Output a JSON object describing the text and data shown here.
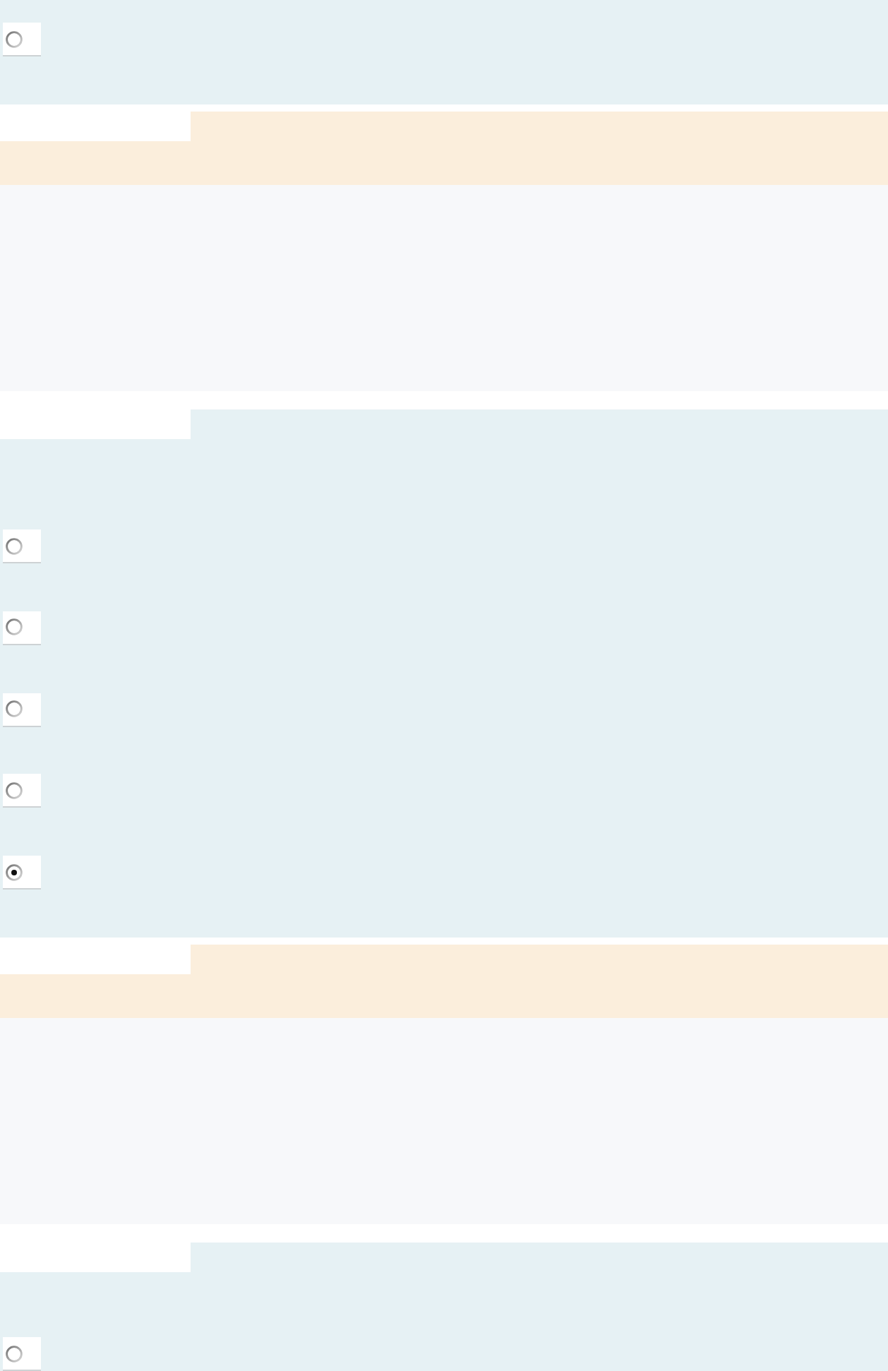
{
  "blocks": [
    {
      "kind": "choices",
      "options": [
        {
          "selected": false
        }
      ]
    },
    {
      "kind": "panel"
    },
    {
      "kind": "choices",
      "options": [
        {
          "selected": false
        },
        {
          "selected": false
        },
        {
          "selected": false
        },
        {
          "selected": false
        },
        {
          "selected": true
        }
      ]
    },
    {
      "kind": "panel"
    },
    {
      "kind": "choices",
      "options": [
        {
          "selected": false
        }
      ]
    }
  ]
}
